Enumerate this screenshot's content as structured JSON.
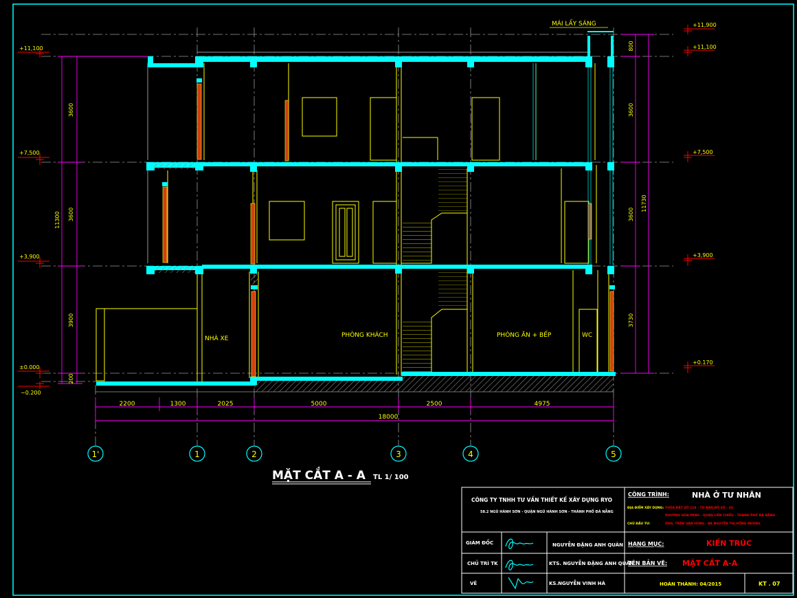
{
  "drawing": {
    "title": "MẶT CẮT A - A",
    "scale": "TL 1/ 100",
    "roof_label": "MÁI LẤY SÁNG",
    "rooms": {
      "garage": "NHÀ XE",
      "living": "PHÒNG KHÁCH",
      "dining_kitchen": "PHÒNG ĂN + BẾP",
      "wc": "WC"
    },
    "levels_left": [
      "+11,100",
      "+7,500",
      "+3,900",
      "±0.000",
      "−0.200"
    ],
    "levels_right": [
      "+11,900",
      "+11,100",
      "+7,500",
      "+3,900",
      "+0.170"
    ],
    "vertical_dims_left": [
      "3600",
      "3600",
      "3900",
      "200"
    ],
    "total_height_left": "11300",
    "vertical_dims_right": [
      "800",
      "3600",
      "3600",
      "3730"
    ],
    "total_height_right": "11730",
    "horizontal_dims": [
      "2200",
      "1300",
      "2025",
      "5000",
      "2500",
      "4975"
    ],
    "total_length": "18000",
    "axes": [
      "1'",
      "1",
      "2",
      "3",
      "4",
      "5"
    ]
  },
  "title_block": {
    "company": "CÔNG TY TNHH TƯ VẤN THIẾT KẾ XÂY DỰNG RYO",
    "company_address": "58.2 NGŨ HÀNH SƠN - QUẬN NGŨ HÀNH SƠN - THÀNH PHỐ ĐÀ NẴNG",
    "project_label": "CÔNG TRÌNH:",
    "project_name": "NHÀ Ở TƯ NHÂN",
    "location_label": "ĐỊA ĐIỂM XÂY DỰNG:",
    "location_line1": "THỬA ĐẤT SỐ 118 - TỜ BẢN ĐỒ SỐ : 24",
    "location_line2": "PHƯỜNG HÒA MINH - QUẬN LIÊN CHIỂU - THÀNH PHỐ ĐÀ NẴNG",
    "owner_label": "CHỦ ĐẦU TƯ:",
    "owner_name": "ÔNG. TRẦN VĂN HÙNG - BÀ NGUYỄN THỊ HỒNG NHUNG",
    "director_role": "GIÁM ĐỐC",
    "director_name": "NGUYỄN ĐẶNG ANH QUÂN",
    "chief_role": "CHỦ TRÌ TK",
    "chief_name": "KTS. NGUYỄN ĐẶNG ANH QUÂN",
    "drawer_role": "VẼ",
    "drawer_name": "KS.NGUYỄN VINH HÀ",
    "category_label": "HẠNG MỤC:",
    "category_value": "KIẾN TRÚC",
    "sheet_name_label": "TÊN BẢN VẼ:",
    "sheet_name_value": "MẶT CẮT A-A",
    "completed": "HOÀN THÀNH: 04/2015",
    "sheet_no": "KT . 07"
  },
  "colors": {
    "slab": "#00ffff",
    "wall_line": "#ffff00",
    "dim": "#ff00ff",
    "level_mark": "#ff0000",
    "text_yellow": "#ffff00",
    "grid": "#9a9a9a",
    "axis_circle": "#00ffff",
    "door": "#d04010"
  }
}
